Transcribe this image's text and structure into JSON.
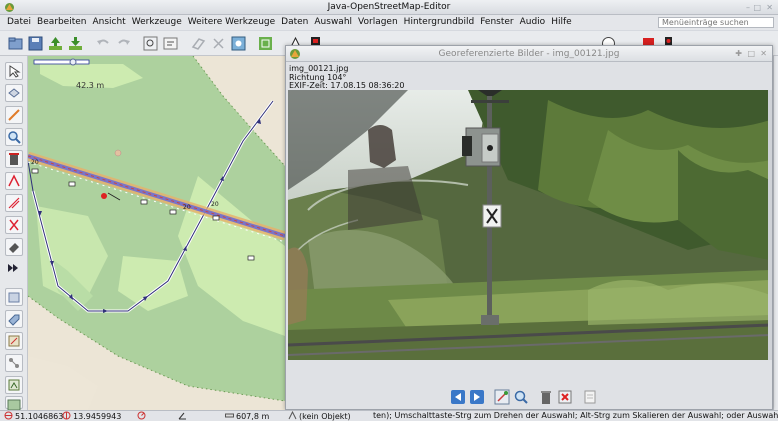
{
  "window": {
    "title": "Java-OpenStreetMap-Editor",
    "icon": "josm-logo-icon",
    "controls": [
      "minimize-icon",
      "maximize-icon",
      "close-icon"
    ]
  },
  "menu": {
    "items": [
      "Datei",
      "Bearbeiten",
      "Ansicht",
      "Werkzeuge",
      "Weitere Werkzeuge",
      "Daten",
      "Auswahl",
      "Vorlagen",
      "Hintergrundbild",
      "Fenster",
      "Audio",
      "Hilfe"
    ],
    "search_placeholder": "Menüeinträge suchen"
  },
  "toolbar": {
    "icons": [
      "open-file-icon",
      "save-icon",
      "upload-icon",
      "download-icon",
      "undo-icon",
      "redo-icon",
      "zoom-fit-icon",
      "preferences-icon",
      "tag-icon",
      "refresh-icon",
      "map-view-icon",
      "preset-icon",
      "signal-icon",
      "tag-preset-icon"
    ]
  },
  "palette": {
    "icons": [
      "select-icon",
      "lasso-icon",
      "draw-icon",
      "zoom-icon",
      "delete-icon",
      "improve-way-icon",
      "parallel-icon",
      "split-icon",
      "eraser-icon",
      "more-icon",
      "layers-icon",
      "tag-list-icon",
      "conflict-icon",
      "relation-icon",
      "history-icon",
      "image-icon"
    ]
  },
  "map": {
    "scale_label": "42.3 m",
    "colors": {
      "forest": "#add19e",
      "meadow": "#cdebb0",
      "road": "#ffffff",
      "railway": "#7a74c8",
      "track": "#30307a"
    }
  },
  "photo_window": {
    "title": "Georeferenzierte Bilder - img_00121.jpg",
    "filename": "img_00121.jpg",
    "direction": "Richtung 104°",
    "exif_time": "EXIF-Zeit: 17.08.15 08:36:20",
    "controls": [
      "previous-image-icon",
      "next-image-icon",
      "center-view-icon",
      "zoom-image-icon",
      "delete-image-icon",
      "remove-image-icon",
      "copy-image-icon"
    ]
  },
  "status": {
    "latitude": "51.1046863",
    "longitude": "13.9459943",
    "distance": "607,8 m",
    "object": "(kein Objekt)",
    "help": "ten); Umschalttaste-Strg zum Drehen der Auswahl; Alt-Strg zum Skalieren der Auswahl; oder Auswahl ändern"
  }
}
